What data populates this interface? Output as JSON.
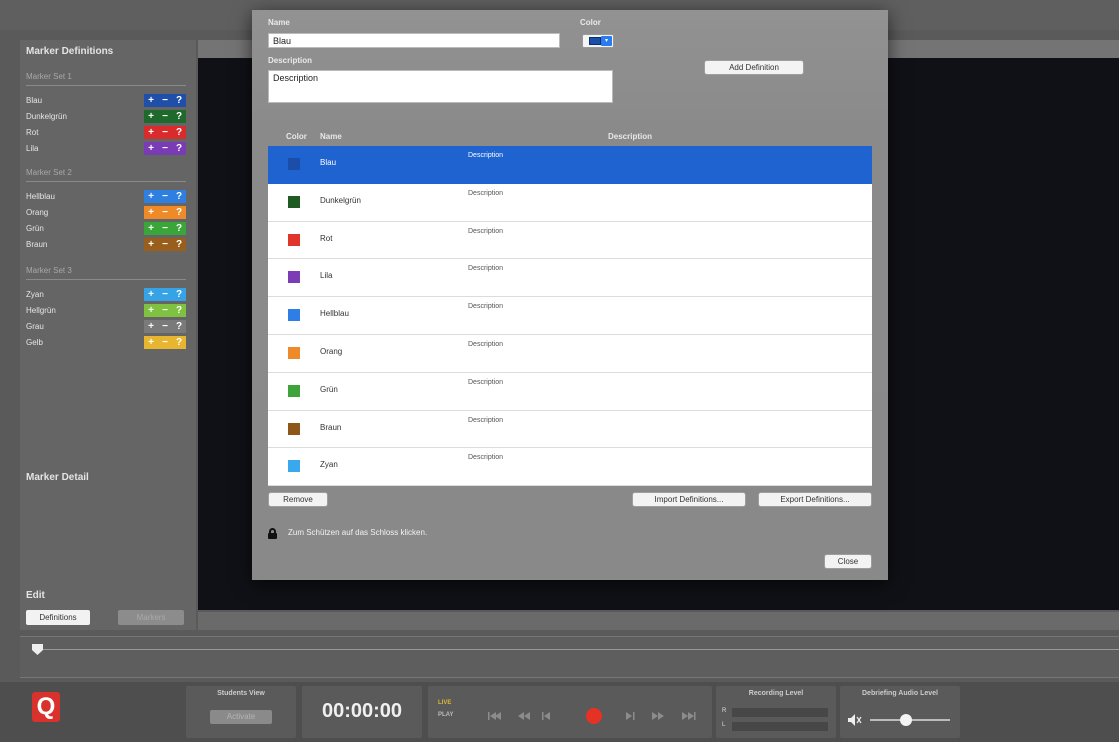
{
  "sidebar": {
    "marker_definitions_title": "Marker Definitions",
    "sets": [
      {
        "label": "Marker Set 1",
        "items": [
          {
            "name": "Blau",
            "color": "#1f4fa8"
          },
          {
            "name": "Dunkelgrün",
            "color": "#1f6a2a"
          },
          {
            "name": "Rot",
            "color": "#d92b2b"
          },
          {
            "name": "Lila",
            "color": "#7a3cb4"
          }
        ]
      },
      {
        "label": "Marker Set 2",
        "items": [
          {
            "name": "Hellblau",
            "color": "#2e7fe0"
          },
          {
            "name": "Orang",
            "color": "#ee8a27"
          },
          {
            "name": "Grün",
            "color": "#3aa63a"
          },
          {
            "name": "Braun",
            "color": "#9a5e1c"
          }
        ]
      },
      {
        "label": "Marker Set 3",
        "items": [
          {
            "name": "Zyan",
            "color": "#36a3e6"
          },
          {
            "name": "Hellgrün",
            "color": "#7fc241"
          },
          {
            "name": "Grau",
            "color": "#7a7a7a"
          },
          {
            "name": "Gelb",
            "color": "#e7b52f"
          }
        ]
      }
    ],
    "marker_detail_title": "Marker Detail",
    "edit_title": "Edit",
    "definitions_button": "Definitions",
    "markers_button": "Markers",
    "plus": "+",
    "minus": "−",
    "question": "?"
  },
  "dialog": {
    "name_label": "Name",
    "name_value": "Blau",
    "color_label": "Color",
    "description_label": "Description",
    "description_value": "Description",
    "add_definition_button": "Add Definition",
    "columns": {
      "color": "Color",
      "name": "Name",
      "description": "Description"
    },
    "rows": [
      {
        "name": "Blau",
        "description": "Description",
        "color": "#1a4ea8",
        "selected": true
      },
      {
        "name": "Dunkelgrün",
        "description": "Description",
        "color": "#1f5a22"
      },
      {
        "name": "Rot",
        "description": "Description",
        "color": "#e0352b"
      },
      {
        "name": "Lila",
        "description": "Description",
        "color": "#7b3cb6"
      },
      {
        "name": "Hellblau",
        "description": "Description",
        "color": "#2f7de6"
      },
      {
        "name": "Orang",
        "description": "Description",
        "color": "#ef8a2a"
      },
      {
        "name": "Grün",
        "description": "Description",
        "color": "#3ea33a"
      },
      {
        "name": "Braun",
        "description": "Description",
        "color": "#8f561a"
      },
      {
        "name": "Zyan",
        "description": "Description",
        "color": "#3aa8ec"
      }
    ],
    "remove_button": "Remove",
    "import_button": "Import Definitions...",
    "export_button": "Export Definitions...",
    "lock_text": "Zum Schützen auf das Schloss klicken.",
    "close_button": "Close"
  },
  "bottom": {
    "logo": "Q",
    "students_view_title": "Students View",
    "activate_button": "Activate",
    "timecode": "00:00:00",
    "live_label": "LIVE",
    "play_label": "PLAY",
    "recording_level_title": "Recording Level",
    "channel_r": "R",
    "channel_l": "L",
    "debriefing_title": "Debriefing Audio Level"
  }
}
